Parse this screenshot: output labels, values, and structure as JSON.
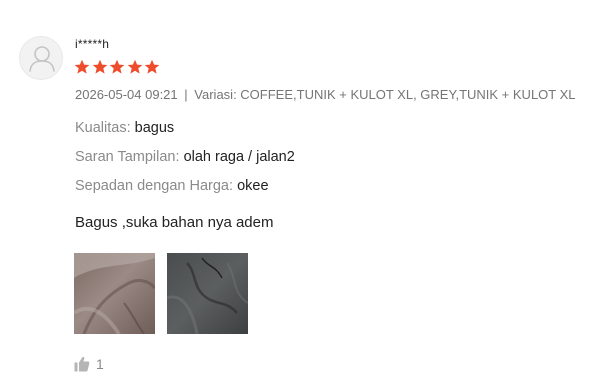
{
  "review": {
    "username": "i*****h",
    "rating": 5,
    "colors": {
      "star": "#ee4d2d",
      "text": "#222222",
      "muted": "#757575"
    },
    "timestamp": "2026-05-04 09:21",
    "separator": "|",
    "variation": "Variasi: COFFEE,TUNIK + KULOT XL, GREY,TUNIK + KULOT XL",
    "attributes": [
      {
        "label": "Kualitas:",
        "value": "bagus"
      },
      {
        "label": "Saran Tampilan:",
        "value": "olah raga / jalan2"
      },
      {
        "label": "Sepadan dengan Harga:",
        "value": "okee"
      }
    ],
    "comment": "Bagus ,suka bahan nya adem",
    "photos": [
      {
        "icon": "fabric-photo-brown"
      },
      {
        "icon": "fabric-photo-grey"
      }
    ],
    "likes": {
      "icon": "thumbs-up-icon",
      "count": "1"
    }
  }
}
